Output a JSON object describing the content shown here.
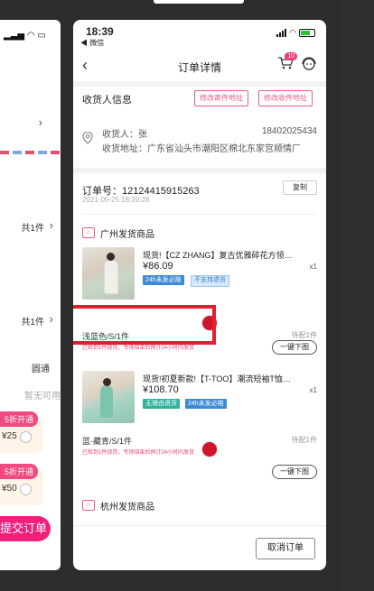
{
  "status": {
    "time": "18:39",
    "back_app": "◀ 微信"
  },
  "nav": {
    "title": "订单详情",
    "back_icon": "‹",
    "cart_badge": "10"
  },
  "receiver": {
    "section_title": "收货人信息",
    "btn_edit_sender": "修改寄件地址",
    "btn_edit_receiver": "修改收件地址",
    "name": "收货人：张",
    "phone": "18402025434",
    "address": "收货地址：广东省汕头市潮阳区棉北东家宫顺情厂"
  },
  "order": {
    "number": "订单号：12124415915263",
    "time": "2021-05-25 18:39:28",
    "copy_label": "复制"
  },
  "warehouses": [
    {
      "label": "广州发货商品"
    },
    {
      "label": "杭州发货商品"
    }
  ],
  "products": [
    {
      "title": "现货!【CZ ZHANG】复古优雅碎花方领…",
      "price": "¥86.09",
      "qty": "x1",
      "tags": [
        "24h未发必赔",
        "不支持退货"
      ],
      "spec": "浅蓝色/S/1件",
      "hint": "已检到1件现货，专场结束后预计24小时内发货",
      "pending": "待配1件",
      "button": "一键下图"
    },
    {
      "title": "现货!初夏新款!【T-TOO】潮流短袖T恤…",
      "price": "¥108.70",
      "qty": "x1",
      "tags": [
        "无理由退货",
        "24h未发必赔"
      ],
      "spec": "蓝-藏青/S/1件",
      "hint": "已检到1件现货，专场结束后预计24小时内发货",
      "pending": "待配1件",
      "button": "一键下图"
    }
  ],
  "footer": {
    "cancel_label": "取消订单"
  },
  "left_panel": {
    "count1": "共1件",
    "count2": "共1件",
    "ship": "圆通",
    "unavailable": "暂无可用",
    "promo1": "5折开通",
    "price1": "¥25",
    "promo2": "5折开通",
    "price2": "¥50",
    "submit": "提交订单"
  },
  "colors": {
    "accent": "#f0207a",
    "highlight": "#e21f2e",
    "tag_blue": "#3b8ad8",
    "tag_teal": "#2db39b"
  }
}
